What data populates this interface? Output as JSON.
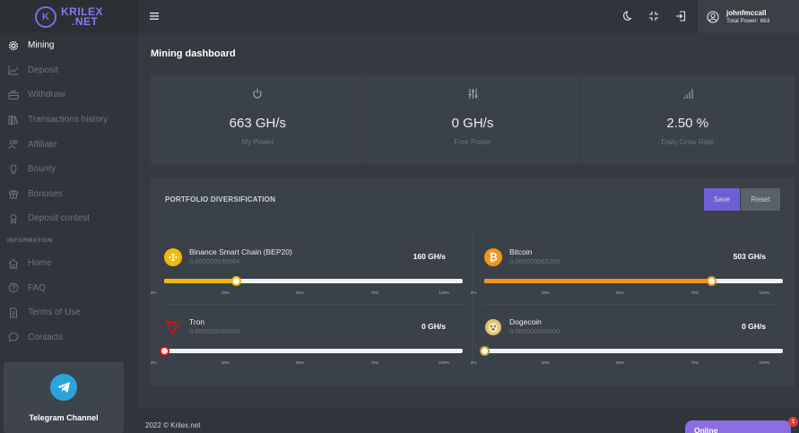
{
  "brand": {
    "line1": "KRILEX",
    "line2": ".NET",
    "mark": "K"
  },
  "sidebar": {
    "items": [
      {
        "label": "Mining",
        "icon": "gear-icon"
      },
      {
        "label": "Deposit",
        "icon": "chart-line-icon"
      },
      {
        "label": "Withdraw",
        "icon": "briefcase-icon"
      },
      {
        "label": "Transactions history",
        "icon": "books-icon"
      },
      {
        "label": "Affiliate",
        "icon": "users-icon"
      },
      {
        "label": "Bounty",
        "icon": "lightbulb-icon"
      },
      {
        "label": "Bonuses",
        "icon": "gift-icon"
      },
      {
        "label": "Deposit contest",
        "icon": "award-icon"
      }
    ],
    "section_label": "INFORMATION",
    "info_items": [
      {
        "label": "Home",
        "icon": "home-icon"
      },
      {
        "label": "FAQ",
        "icon": "question-icon"
      },
      {
        "label": "Terms of Use",
        "icon": "document-icon"
      },
      {
        "label": "Contacts",
        "icon": "chat-icon"
      }
    ],
    "telegram_label": "Telegram Channel"
  },
  "header": {
    "username": "johnfmccall",
    "total_power": "Total Power: 663"
  },
  "main": {
    "title": "Mining dashboard",
    "stats": [
      {
        "value": "663 GH/s",
        "label": "My Power",
        "icon": "power-icon"
      },
      {
        "value": "0 GH/s",
        "label": "Free Power",
        "icon": "sliders-icon"
      },
      {
        "value": "2.50 %",
        "label": "Daily Grow Rate",
        "icon": "signal-icon"
      }
    ],
    "portfolio": {
      "title": "PORTFOLIO DIVERSIFICATION",
      "save_label": "Save",
      "reset_label": "Reset",
      "ticks": [
        "0%",
        "25%",
        "50%",
        "75%",
        "100%"
      ],
      "coins": [
        {
          "name": "Binance Smart Chain (BEP20)",
          "balance": "0.000000530064",
          "power": "160 GH/s",
          "percent": 24,
          "color": "#f0b90b",
          "icon": "bnb-icon"
        },
        {
          "name": "Bitcoin",
          "balance": "0.000000065269",
          "power": "503 GH/s",
          "percent": 76,
          "color": "#f7931a",
          "icon": "bitcoin-icon"
        },
        {
          "name": "Tron",
          "balance": "0.000000000000",
          "power": "0 GH/s",
          "percent": 0,
          "color": "#e50915",
          "icon": "tron-icon"
        },
        {
          "name": "Dogecoin",
          "balance": "0.000000000000",
          "power": "0 GH/s",
          "percent": 0,
          "color": "#c2a633",
          "icon": "dogecoin-icon"
        }
      ]
    }
  },
  "footer": {
    "copyright": "2022 © Krilex.net",
    "online_label": "Online",
    "online_badge": "1"
  }
}
